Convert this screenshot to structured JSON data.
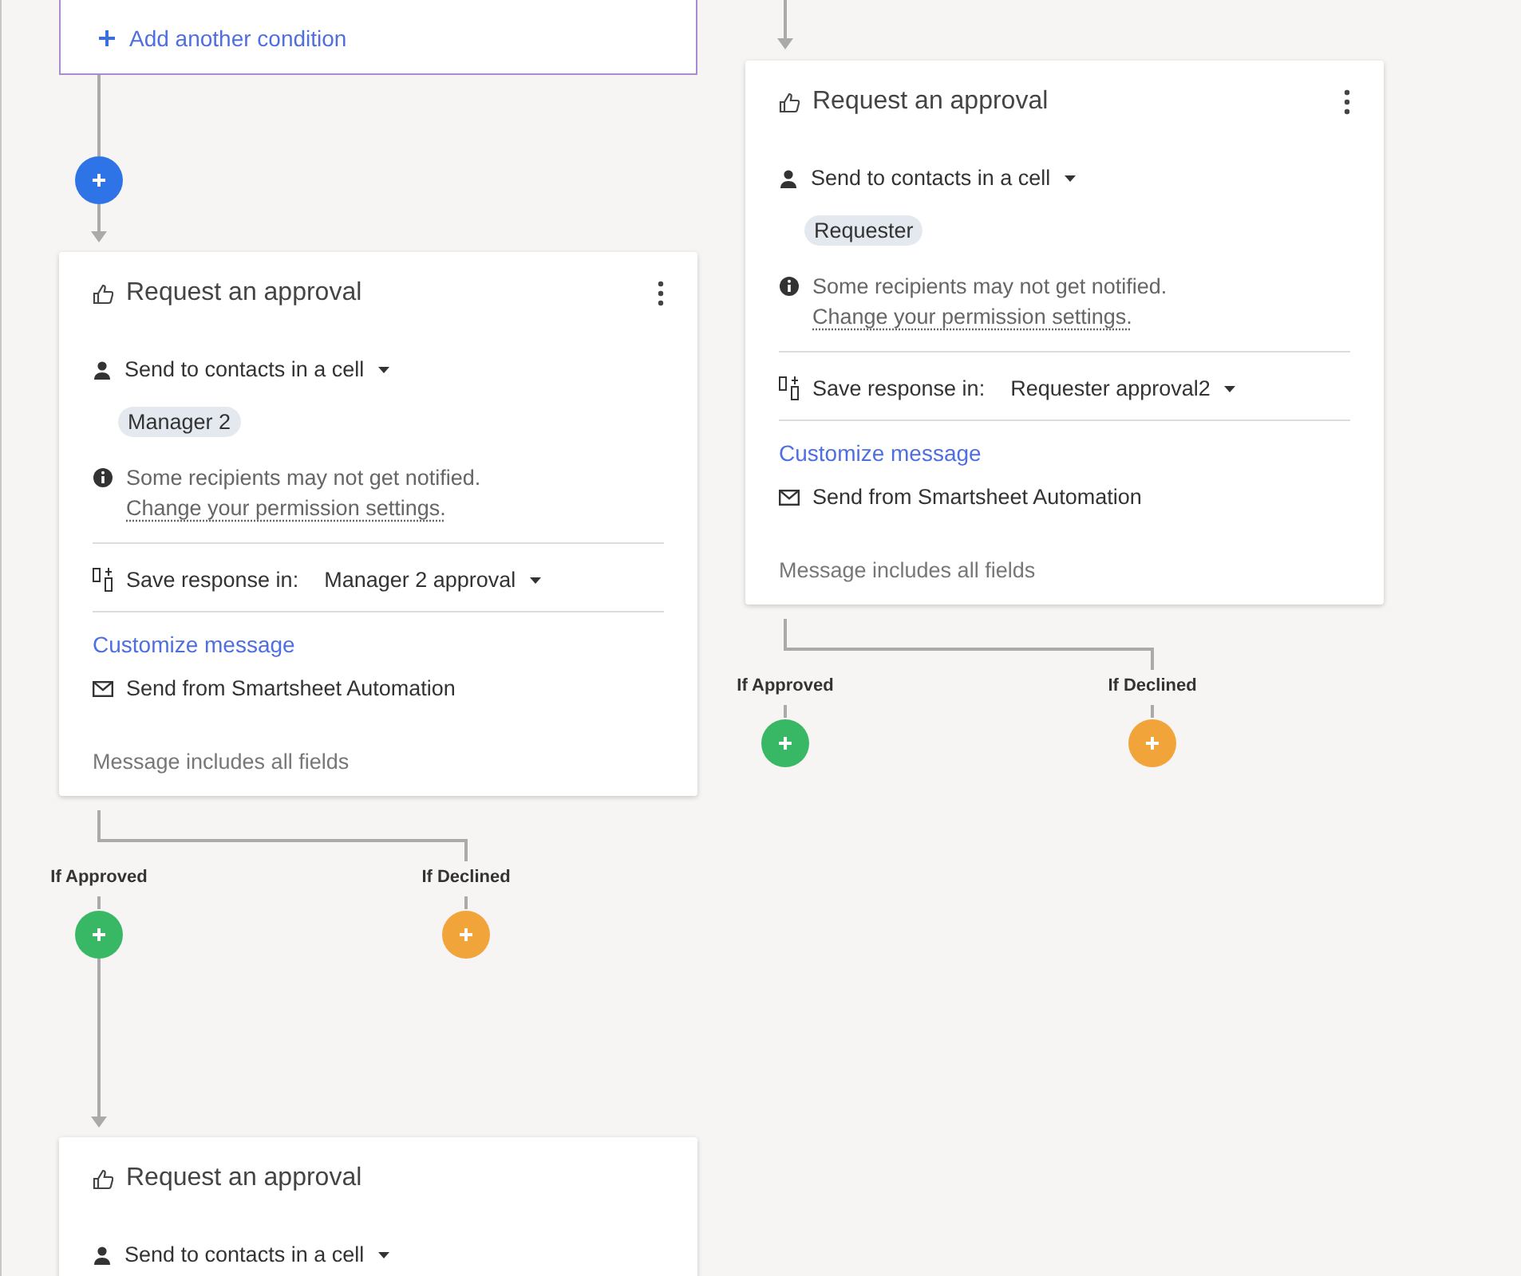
{
  "condition_card": {
    "link": "Add another condition"
  },
  "cards": [
    {
      "title": "Request an approval",
      "recipients": "Send to contacts in a cell",
      "chip": "Manager 2",
      "warning": "Some recipients may not get notified.",
      "warning_link": "Change your permission settings.",
      "save_label": "Save response in:",
      "save_value": "Manager 2 approval",
      "customize": "Customize message",
      "send_from": "Send from Smartsheet Automation",
      "message_info": "Message includes all fields",
      "branches": [
        {
          "label": "If Approved",
          "color": "#38b865"
        },
        {
          "label": "If Declined",
          "color": "#f0a43a"
        }
      ]
    },
    {
      "title": "Request an approval",
      "recipients": "Send to contacts in a cell",
      "chip": "Requester",
      "warning": "Some recipients may not get notified.",
      "warning_link": "Change your permission settings.",
      "save_label": "Save response in:",
      "save_value": "Requester approval2",
      "customize": "Customize message",
      "send_from": "Send from Smartsheet Automation",
      "message_info": "Message includes all fields",
      "branches": [
        {
          "label": "If Approved",
          "color": "#38b865"
        },
        {
          "label": "If Declined",
          "color": "#f0a43a"
        }
      ]
    },
    {
      "title": "Request an approval",
      "recipients": "Send to contacts in a cell"
    }
  ]
}
